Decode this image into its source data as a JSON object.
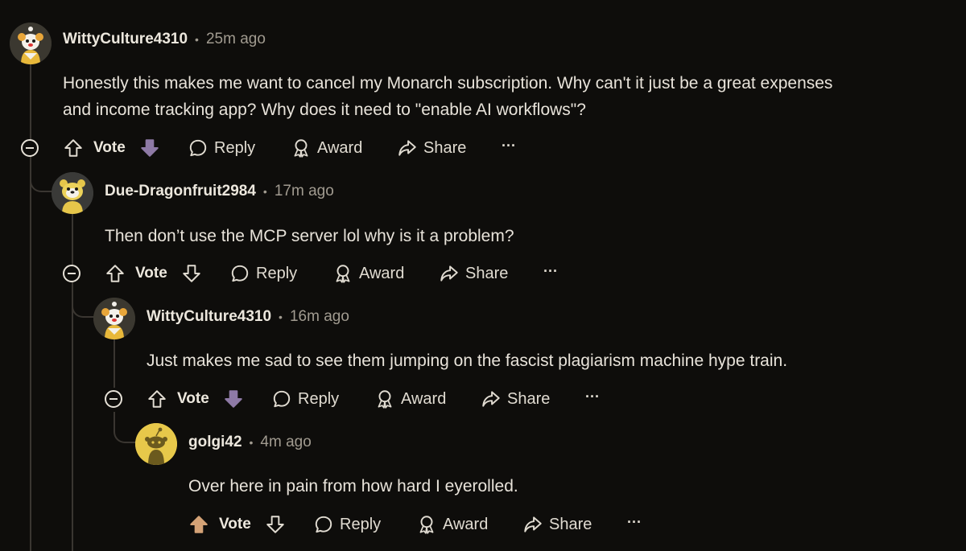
{
  "comments": [
    {
      "username": "WittyCulture4310",
      "time": "25m ago",
      "body_lines": [
        "Honestly this makes me want to cancel my Monarch subscription. Why can't it just be a great expenses",
        "and income tracking app? Why does it need to \"enable AI workflows\"?"
      ],
      "vote_state": "downvoted",
      "avatar": "snoo-clown-avatar"
    },
    {
      "username": "Due-Dragonfruit2984",
      "time": "17m ago",
      "body_lines": [
        "Then don’t use the MCP server lol why is it a problem?"
      ],
      "vote_state": "none",
      "avatar": "snoo-bear-avatar"
    },
    {
      "username": "WittyCulture4310",
      "time": "16m ago",
      "body_lines": [
        "Just makes me sad to see them jumping on the fascist plagiarism machine hype train."
      ],
      "vote_state": "downvoted",
      "avatar": "snoo-clown-avatar"
    },
    {
      "username": "golgi42",
      "time": "4m ago",
      "body_lines": [
        "Over here in pain from how hard I eyerolled."
      ],
      "vote_state": "upvoted",
      "avatar": "snoo-default-avatar"
    }
  ],
  "actions": {
    "separator": "•",
    "vote_label": "Vote",
    "reply_label": "Reply",
    "award_label": "Award",
    "share_label": "Share",
    "more_label": "···"
  },
  "colors": {
    "background": "#0e0d0b",
    "text": "#e8e3da",
    "muted": "#a19b90",
    "downvote": "#8e7aa6",
    "upvote": "#d4a276",
    "thread_line": "#3a3631"
  }
}
